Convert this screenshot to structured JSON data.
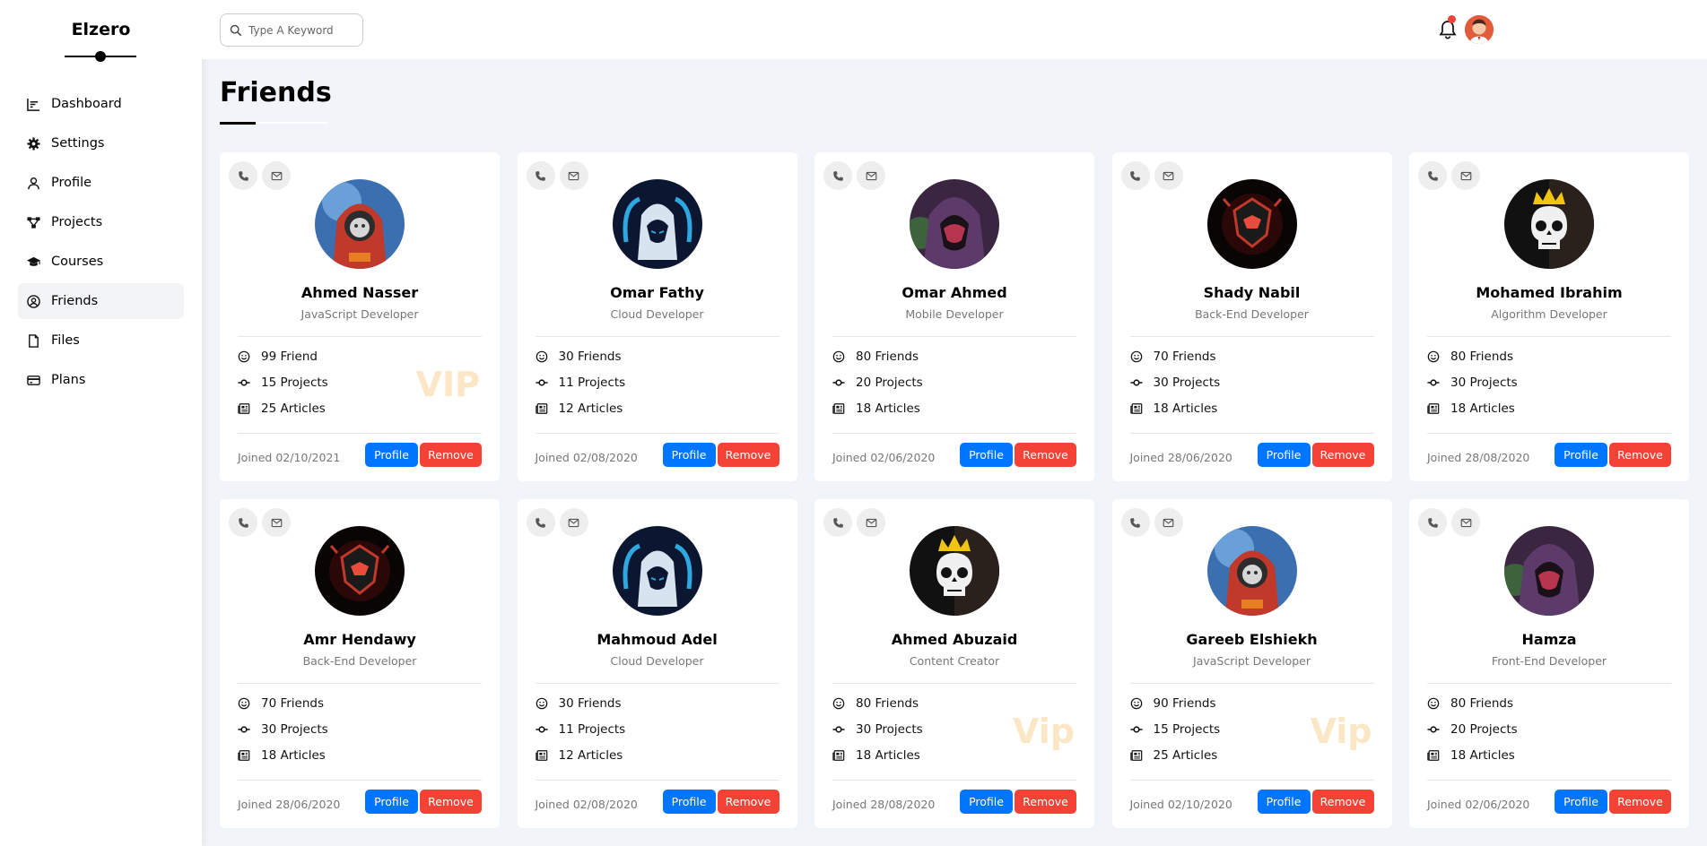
{
  "sidebar": {
    "brand": "Elzero",
    "items": [
      {
        "label": "Dashboard",
        "icon": "chart-icon"
      },
      {
        "label": "Settings",
        "icon": "gear-icon"
      },
      {
        "label": "Profile",
        "icon": "user-icon"
      },
      {
        "label": "Projects",
        "icon": "diagram-icon"
      },
      {
        "label": "Courses",
        "icon": "graduation-cap-icon"
      },
      {
        "label": "Friends",
        "icon": "user-circle-icon",
        "active": true
      },
      {
        "label": "Files",
        "icon": "file-icon"
      },
      {
        "label": "Plans",
        "icon": "credit-card-icon"
      }
    ]
  },
  "topbar": {
    "search_placeholder": "Type A Keyword",
    "notification_dot_color": "#f44336"
  },
  "page": {
    "title": "Friends"
  },
  "colors": {
    "profile_button": "#0075ff",
    "remove_button": "#f44336",
    "vip": "#fbe7c6"
  },
  "friends": [
    {
      "name": "Ahmed Nasser",
      "role": "JavaScript Developer",
      "friends": "99 Friend",
      "projects": "15 Projects",
      "articles": "25 Articles",
      "joined": "Joined 02/10/2021",
      "vip": "VIP",
      "avatar": "red-hooded-character"
    },
    {
      "name": "Omar Fathy",
      "role": "Cloud Developer",
      "friends": "30 Friends",
      "projects": "11 Projects",
      "articles": "12 Articles",
      "joined": "Joined 02/08/2020",
      "vip": "",
      "avatar": "blue-hooded-character"
    },
    {
      "name": "Omar Ahmed",
      "role": "Mobile Developer",
      "friends": "80 Friends",
      "projects": "20 Projects",
      "articles": "18 Articles",
      "joined": "Joined 02/06/2020",
      "vip": "",
      "avatar": "purple-hooded-mask"
    },
    {
      "name": "Shady Nabil",
      "role": "Back-End Developer",
      "friends": "70 Friends",
      "projects": "30 Projects",
      "articles": "18 Articles",
      "joined": "Joined 28/06/2020",
      "vip": "",
      "avatar": "red-dark-emblem"
    },
    {
      "name": "Mohamed Ibrahim",
      "role": "Algorithm Developer",
      "friends": "80 Friends",
      "projects": "30 Projects",
      "articles": "18 Articles",
      "joined": "Joined 28/08/2020",
      "vip": "",
      "avatar": "crowned-skull"
    },
    {
      "name": "Amr Hendawy",
      "role": "Back-End Developer",
      "friends": "70 Friends",
      "projects": "30 Projects",
      "articles": "18 Articles",
      "joined": "Joined 28/06/2020",
      "vip": "",
      "avatar": "red-dark-emblem"
    },
    {
      "name": "Mahmoud Adel",
      "role": "Cloud Developer",
      "friends": "30 Friends",
      "projects": "11 Projects",
      "articles": "12 Articles",
      "joined": "Joined 02/08/2020",
      "vip": "",
      "avatar": "blue-hooded-character"
    },
    {
      "name": "Ahmed Abuzaid",
      "role": "Content Creator",
      "friends": "80 Friends",
      "projects": "30 Projects",
      "articles": "18 Articles",
      "joined": "Joined 28/08/2020",
      "vip": "Vip",
      "avatar": "crowned-skull"
    },
    {
      "name": "Gareeb Elshiekh",
      "role": "JavaScript Developer",
      "friends": "90 Friends",
      "projects": "15 Projects",
      "articles": "25 Articles",
      "joined": "Joined 02/10/2020",
      "vip": "Vip",
      "avatar": "red-hooded-character"
    },
    {
      "name": "Hamza",
      "role": "Front-End Developer",
      "friends": "80 Friends",
      "projects": "20 Projects",
      "articles": "18 Articles",
      "joined": "Joined 02/06/2020",
      "vip": "",
      "avatar": "purple-hooded-mask"
    }
  ],
  "labels": {
    "profile_button": "Profile",
    "remove_button": "Remove"
  }
}
